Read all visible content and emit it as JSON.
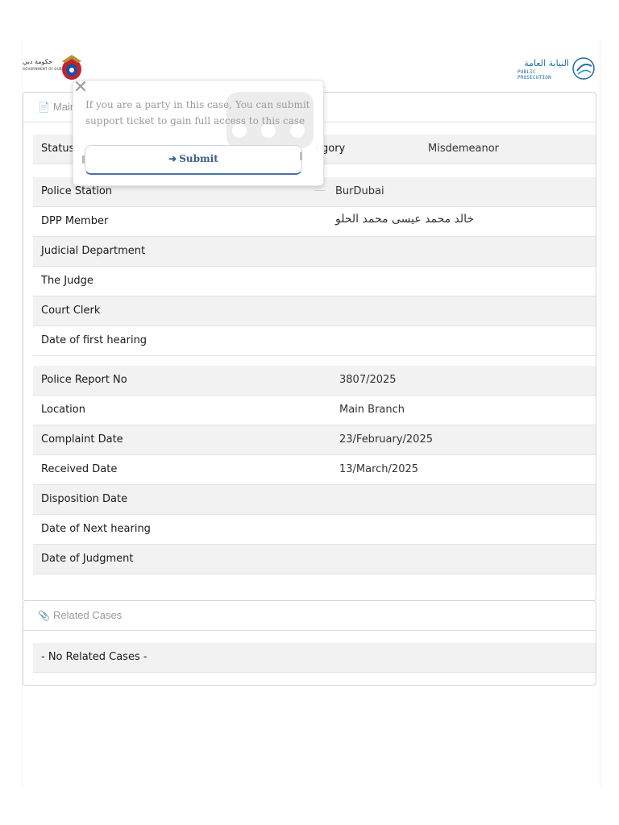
{
  "header": {
    "gov_logo_ar": "حكومة دبي",
    "gov_logo_en": "GOVERNMENT OF DUBAI",
    "pp_logo_ar": "النيابة العامة",
    "pp_logo_en": "PUBLIC PROSECUTION"
  },
  "main_panel": {
    "title": "Main",
    "rows_top": [
      {
        "label": "Status",
        "value": "",
        "label2": "egory",
        "value2": "Misdemeanor"
      },
      {
        "label": "Police Station",
        "value": "BurDubai"
      },
      {
        "label": "DPP Member",
        "value": "خالد محمد عيسى محمد الحلو"
      },
      {
        "label": "Judicial Department",
        "value": ""
      },
      {
        "label": "The Judge",
        "value": ""
      },
      {
        "label": "Court Clerk",
        "value": ""
      },
      {
        "label": "Date of first hearing",
        "value": ""
      }
    ],
    "rows_bottom": [
      {
        "label": "Police Report No",
        "value": "3807/2025"
      },
      {
        "label": "Location",
        "value": "Main Branch"
      },
      {
        "label": "Complaint Date",
        "value": "23/February/2025"
      },
      {
        "label": "Received Date",
        "value": "13/March/2025"
      },
      {
        "label": "Disposition Date",
        "value": ""
      },
      {
        "label": "Date of Next hearing",
        "value": ""
      },
      {
        "label": "Date of Judgment",
        "value": ""
      }
    ]
  },
  "related_panel": {
    "title": "Related Cases",
    "empty_text": "- No Related Cases -"
  },
  "popup": {
    "message": "If you are a party in this case, You can submit support ticket to gain full access to this case",
    "submit_label": "Submit",
    "close_glyph": "✕"
  },
  "icons": {
    "file": "file-icon",
    "paperclip": "paperclip-icon",
    "sign_in": "sign-in-icon",
    "close": "close-icon",
    "chat_bubble": "chat-bubble-icon"
  }
}
